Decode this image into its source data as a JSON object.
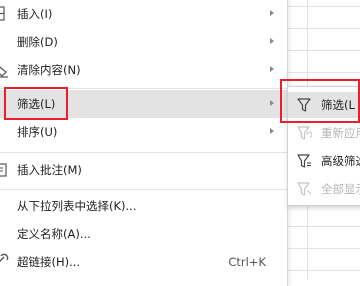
{
  "context_menu": {
    "items": [
      {
        "label": "插入(I)",
        "has_submenu": true,
        "icon": "insert-icon"
      },
      {
        "label": "删除(D)",
        "has_submenu": true
      },
      {
        "label": "清除内容(N)",
        "has_submenu": true,
        "icon": "clear-icon"
      },
      {
        "label": "筛选(L)",
        "has_submenu": true,
        "highlighted": true
      },
      {
        "label": "排序(U)",
        "has_submenu": true
      },
      {
        "label": "插入批注(M)",
        "icon": "comment-icon"
      },
      {
        "label": "从下拉列表中选择(K)..."
      },
      {
        "label": "定义名称(A)..."
      },
      {
        "label": "超链接(H)...",
        "shortcut": "Ctrl+K",
        "icon": "hyperlink-icon"
      }
    ]
  },
  "filter_submenu": {
    "items": [
      {
        "label": "筛选(L",
        "icon": "filter-icon",
        "enabled": true,
        "highlighted": true
      },
      {
        "label": "重新应用",
        "icon": "reapply-filter-icon",
        "enabled": false
      },
      {
        "label": "高级筛选",
        "icon": "advanced-filter-icon",
        "enabled": true
      },
      {
        "label": "全部显示",
        "icon": "show-all-icon",
        "enabled": false
      }
    ]
  },
  "colors": {
    "highlight_box": "#e8202a",
    "hover_background": "#e3e3e3",
    "disabled_text": "#b4b4b4"
  }
}
